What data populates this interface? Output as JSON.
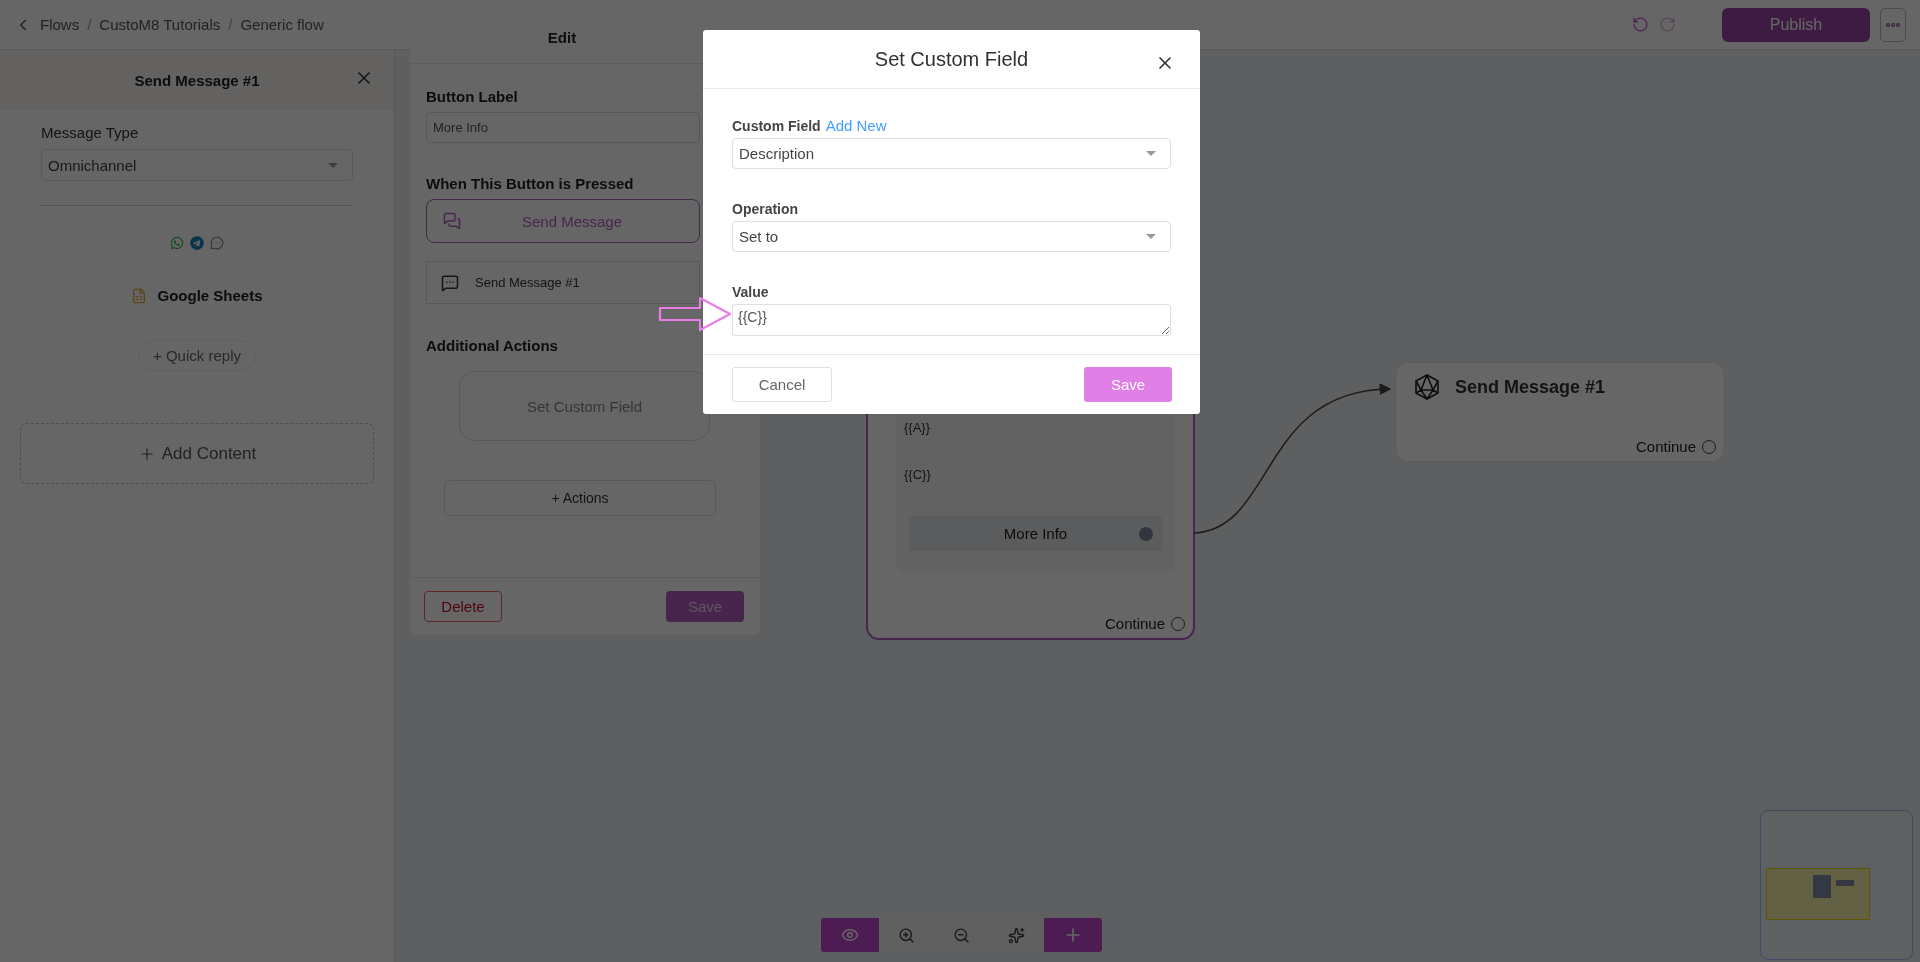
{
  "breadcrumb": {
    "items": [
      {
        "kind": "link",
        "text": "Flows"
      },
      {
        "kind": "separator",
        "text": "/"
      },
      {
        "kind": "link",
        "text": "CustoM8 Tutorials"
      },
      {
        "kind": "separator",
        "text": "/"
      },
      {
        "kind": "link",
        "text": "Generic flow"
      }
    ]
  },
  "header": {
    "publish": "Publish"
  },
  "left_panel": {
    "title": "Send Message #1",
    "message_type_label": "Message Type",
    "message_type": "Omnichannel",
    "sheet": "Google Sheets",
    "quick_reply": "+ Quick reply",
    "add_content": "Add Content"
  },
  "edit_panel": {
    "title": "Edit",
    "button_label_label": "Button Label",
    "button_label": "More Info",
    "pressed_label": "When This Button is Pressed",
    "action_type": "Send Message",
    "target": "Send Message #1",
    "additional_label": "Additional Actions",
    "additional_actions": [
      "Set Custom Field"
    ],
    "add_actions": "+ Actions",
    "delete": "Delete",
    "save": "Save"
  },
  "canvas": {
    "message_node": {
      "selected": true,
      "lines": [
        "{{A}}",
        "{{C}}"
      ],
      "button": "More Info",
      "output": "Continue"
    },
    "target_node": {
      "selected": false,
      "title": "Send Message #1",
      "output": "Continue"
    }
  },
  "modal": {
    "title": "Set Custom Field",
    "fields": [
      {
        "kind": "select",
        "label": "Custom Field",
        "link": "Add New",
        "value": "Description"
      },
      {
        "kind": "select",
        "label": "Operation",
        "value": "Set to"
      },
      {
        "kind": "textarea",
        "label": "Value",
        "value": "{{C}}"
      }
    ],
    "cancel": "Cancel",
    "save": "Save"
  }
}
